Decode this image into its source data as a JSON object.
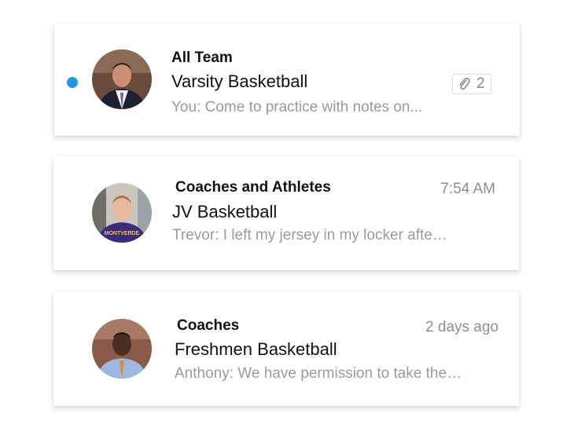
{
  "threads": [
    {
      "group": "All Team",
      "subject": "Varsity Basketball",
      "preview": "You: Come to practice with notes on...",
      "unread": true,
      "attachment_count": "2",
      "avatar_icon": "avatar-man-suit"
    },
    {
      "group": "Coaches and Athletes",
      "subject": "JV Basketball",
      "preview": "Trevor: I left my jersey in my locker afte…",
      "time": "7:54 AM",
      "avatar_icon": "avatar-young-man-purple-shirt"
    },
    {
      "group": "Coaches",
      "subject": "Freshmen Basketball",
      "preview": "Anthony: We have permission to take the…",
      "time": "2 days ago",
      "avatar_icon": "avatar-man-blue-shirt"
    }
  ],
  "colors": {
    "unread_dot": "#1d9ae2",
    "preview_text": "#9a9a9a",
    "time_text": "#8e8e8e"
  }
}
